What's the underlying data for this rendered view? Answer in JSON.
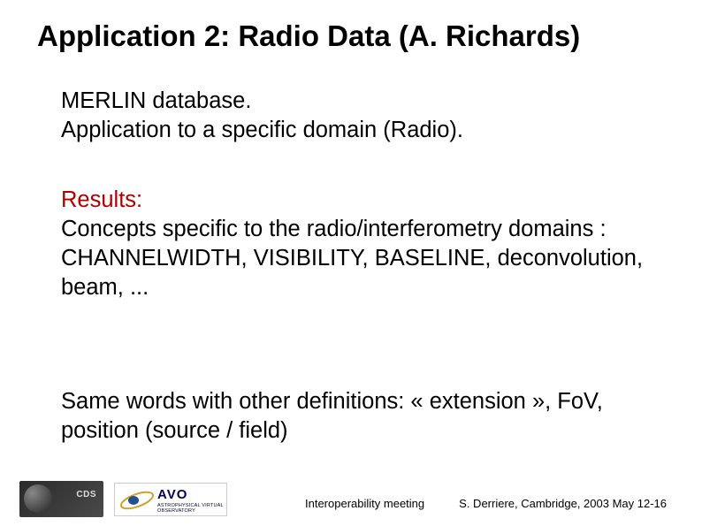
{
  "title": "Application 2: Radio Data (A. Richards)",
  "body": {
    "line1": "MERLIN database.",
    "line2": "Application to a specific domain (Radio)."
  },
  "results": {
    "heading": "Results:",
    "line1": "Concepts specific to the radio/interferometry domains :",
    "line2": "CHANNELWIDTH, VISIBILITY, BASELINE, deconvolution, beam, ..."
  },
  "final": {
    "text": "Same words with other definitions: « extension », FoV, position (source / field)"
  },
  "footer": {
    "logos": {
      "cds_label": "CDS",
      "avo_main": "AVO",
      "avo_sub": "ASTROPHYSICAL VIRTUAL OBSERVATORY"
    },
    "center": "Interoperability meeting",
    "right": "S. Derriere,  Cambridge, 2003 May 12-16"
  }
}
